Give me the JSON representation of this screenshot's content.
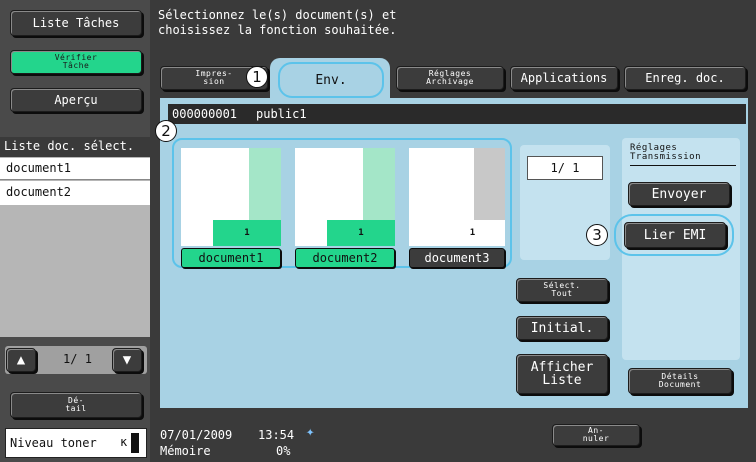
{
  "left_panel": {
    "task_list_label": "Liste Tâches",
    "check_task_label": "Vérifier\nTâche",
    "preview_label": "Aperçu",
    "selected_docs_title": "Liste doc. sélect.",
    "selected_docs": [
      "document1",
      "document2"
    ],
    "pager": "1/ 1",
    "detail_label": "Dé-\ntail",
    "toner_label": "Niveau toner"
  },
  "header": {
    "instruction_line1": "Sélectionnez le(s) document(s) et",
    "instruction_line2": "choisissez la fonction souhaitée."
  },
  "tabs": [
    {
      "label": "Impres-\nsion",
      "active": false
    },
    {
      "label": "Env.",
      "active": true
    },
    {
      "label": "Réglages\nArchivage",
      "active": false
    },
    {
      "label": "Applications",
      "active": false
    },
    {
      "label": "Enreg. doc.",
      "active": false
    }
  ],
  "box": {
    "id": "000000001",
    "name": "public1"
  },
  "documents": [
    {
      "label": "document1",
      "pages": "1",
      "selected": true
    },
    {
      "label": "document2",
      "pages": "1",
      "selected": true
    },
    {
      "label": "document3",
      "pages": "1",
      "selected": false
    }
  ],
  "page_counter": "1/ 1",
  "actions": {
    "select_all": "Sélect.\nTout",
    "reset": "Initial.",
    "show_list": "Afficher\nListe"
  },
  "transmission": {
    "title": "Réglages\nTransmission",
    "send": "Envoyer",
    "bind": "Lier EMI",
    "details": "Détails\nDocument"
  },
  "cancel_label": "An-\nnuler",
  "status": {
    "date": "07/01/2009",
    "time": "13:54",
    "memory_label": "Mémoire",
    "memory_value": "0%"
  },
  "callouts": [
    "1",
    "2",
    "3"
  ],
  "colors": {
    "background": "#ffffff",
    "dark_gray": "#3a3a3a",
    "accent_green": "#23d58c",
    "panel_blue": "#a8d2e4",
    "highlight_blue": "#5cc3ea"
  }
}
